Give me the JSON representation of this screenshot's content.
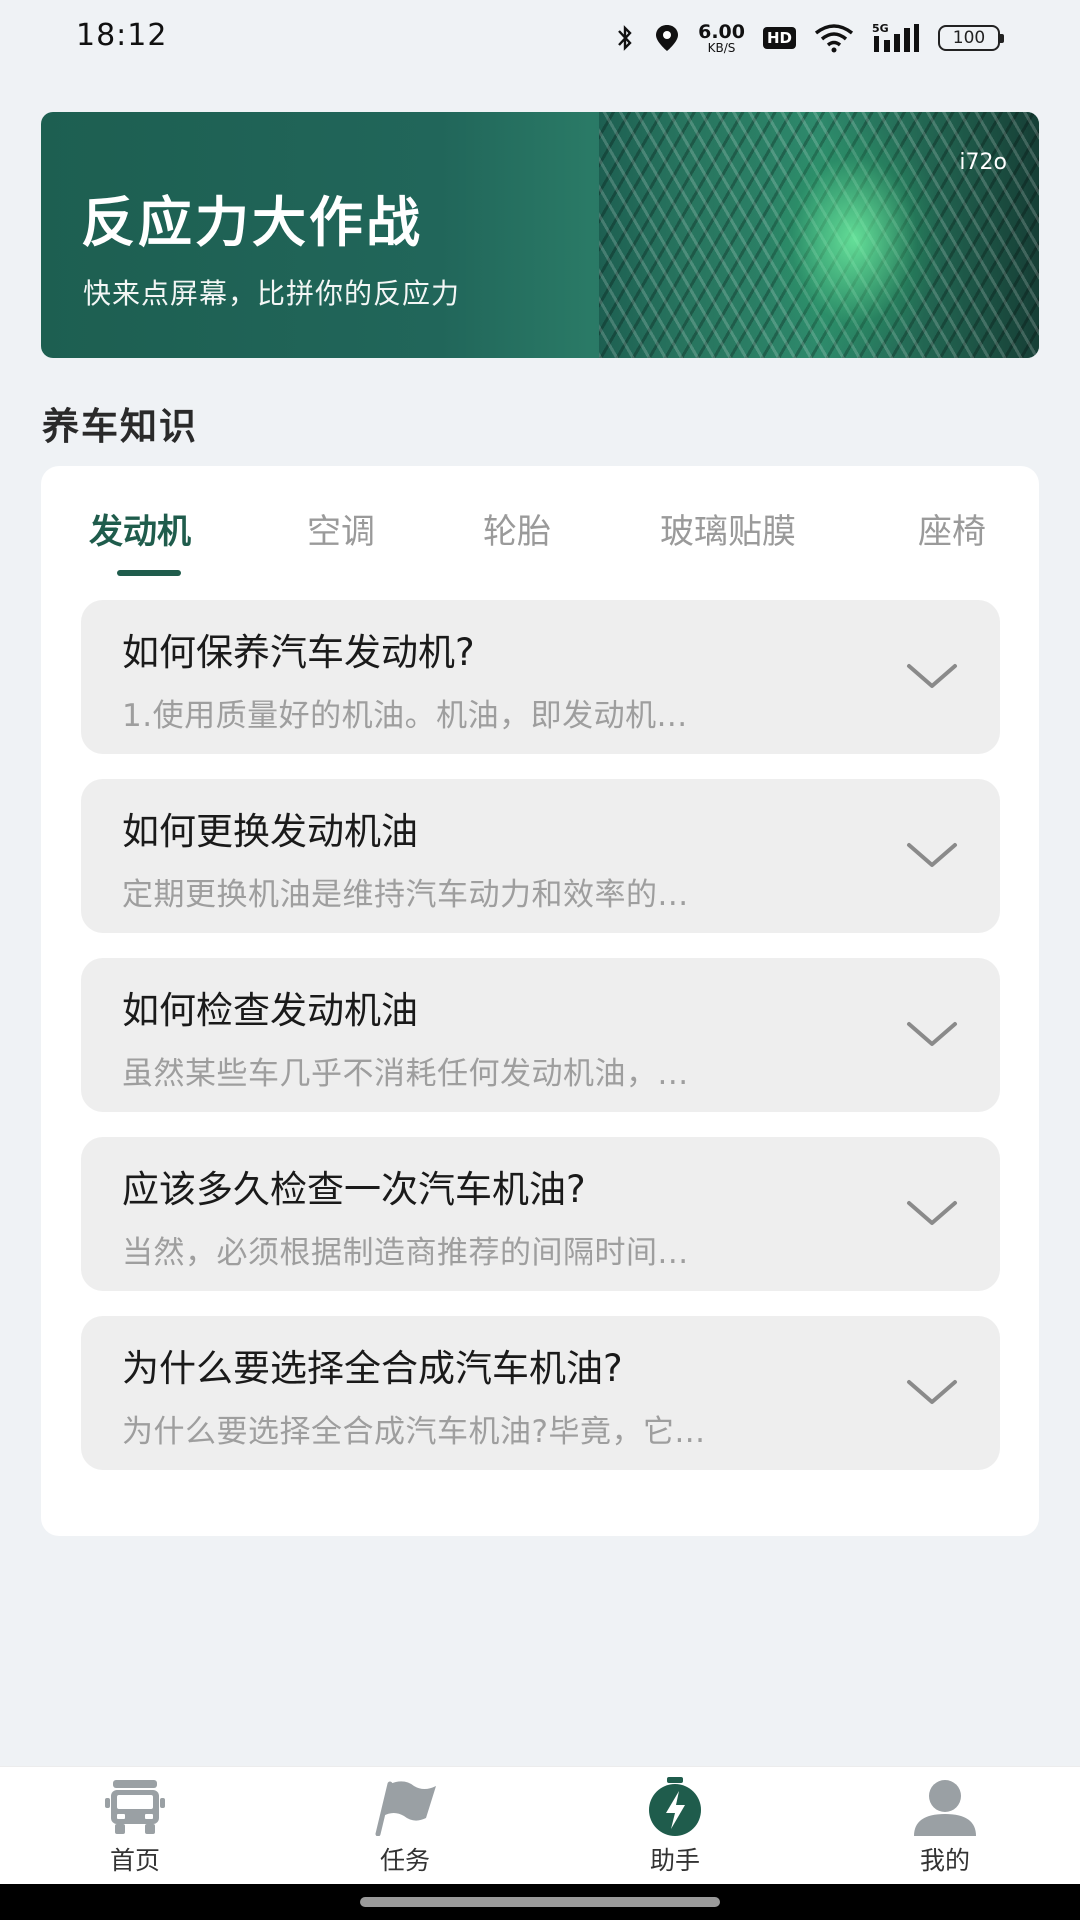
{
  "status_bar": {
    "time": "18:12",
    "net_speed_value": "6.00",
    "net_speed_unit": "KB/S",
    "hd_label": "HD",
    "signal_label": "5G",
    "battery": "100",
    "icons": [
      "bluetooth-icon",
      "location-icon",
      "wifi-icon",
      "signal-icon",
      "battery-icon"
    ]
  },
  "banner": {
    "title": "反应力大作战",
    "subtitle": "快来点屏幕，比拼你的反应力",
    "tag": "i72o"
  },
  "section": {
    "title": "养车知识"
  },
  "tabs": [
    {
      "label": "发动机",
      "active": true
    },
    {
      "label": "空调",
      "active": false
    },
    {
      "label": "轮胎",
      "active": false
    },
    {
      "label": "玻璃贴膜",
      "active": false
    },
    {
      "label": "座椅",
      "active": false
    }
  ],
  "qa_items": [
    {
      "question": "如何保养汽车发动机?",
      "answer": "1.使用质量好的机油。机油，即发动机..."
    },
    {
      "question": "如何更换发动机油",
      "answer": "定期更换机油是维持汽车动力和效率的..."
    },
    {
      "question": "如何检查发动机油",
      "answer": "虽然某些车几乎不消耗任何发动机油，..."
    },
    {
      "question": "应该多久检查一次汽车机油?",
      "answer": "当然，必须根据制造商推荐的间隔时间..."
    },
    {
      "question": "为什么要选择全合成汽车机油?",
      "answer": "为什么要选择全合成汽车机油?毕竟，它..."
    }
  ],
  "bottom_nav": [
    {
      "label": "首页",
      "icon": "truck-icon",
      "active": false
    },
    {
      "label": "任务",
      "icon": "flag-icon",
      "active": false
    },
    {
      "label": "助手",
      "icon": "lightning-icon",
      "active": true
    },
    {
      "label": "我的",
      "icon": "user-icon",
      "active": false
    }
  ],
  "colors": {
    "accent": "#1f5c4c",
    "background": "#eff2f5",
    "item_background": "#eeeeee",
    "inactive_icon": "#9aa0a4"
  }
}
